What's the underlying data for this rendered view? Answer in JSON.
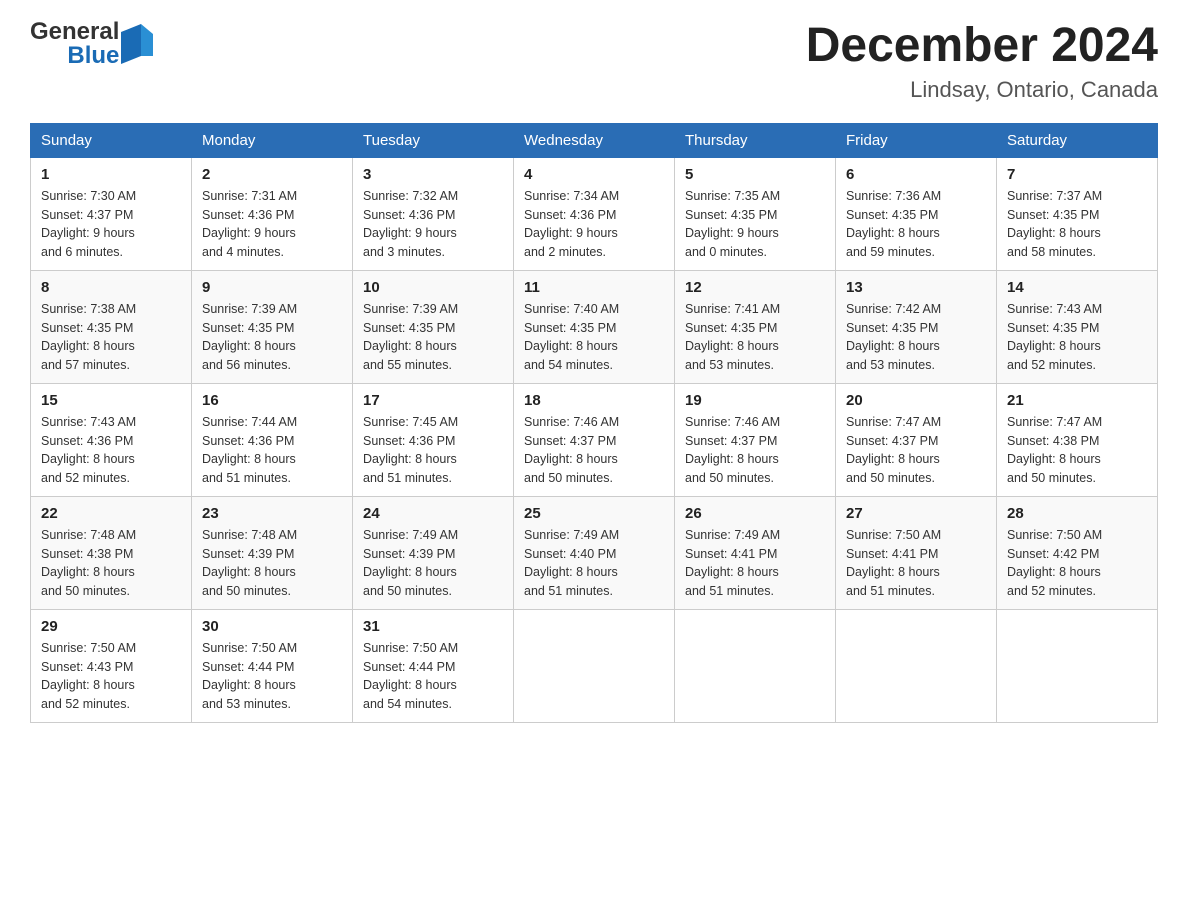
{
  "logo": {
    "text_general": "General",
    "text_blue": "Blue"
  },
  "title": "December 2024",
  "location": "Lindsay, Ontario, Canada",
  "days_of_week": [
    "Sunday",
    "Monday",
    "Tuesday",
    "Wednesday",
    "Thursday",
    "Friday",
    "Saturday"
  ],
  "weeks": [
    [
      {
        "day": "1",
        "sunrise": "7:30 AM",
        "sunset": "4:37 PM",
        "daylight": "9 hours and 6 minutes."
      },
      {
        "day": "2",
        "sunrise": "7:31 AM",
        "sunset": "4:36 PM",
        "daylight": "9 hours and 4 minutes."
      },
      {
        "day": "3",
        "sunrise": "7:32 AM",
        "sunset": "4:36 PM",
        "daylight": "9 hours and 3 minutes."
      },
      {
        "day": "4",
        "sunrise": "7:34 AM",
        "sunset": "4:36 PM",
        "daylight": "9 hours and 2 minutes."
      },
      {
        "day": "5",
        "sunrise": "7:35 AM",
        "sunset": "4:35 PM",
        "daylight": "9 hours and 0 minutes."
      },
      {
        "day": "6",
        "sunrise": "7:36 AM",
        "sunset": "4:35 PM",
        "daylight": "8 hours and 59 minutes."
      },
      {
        "day": "7",
        "sunrise": "7:37 AM",
        "sunset": "4:35 PM",
        "daylight": "8 hours and 58 minutes."
      }
    ],
    [
      {
        "day": "8",
        "sunrise": "7:38 AM",
        "sunset": "4:35 PM",
        "daylight": "8 hours and 57 minutes."
      },
      {
        "day": "9",
        "sunrise": "7:39 AM",
        "sunset": "4:35 PM",
        "daylight": "8 hours and 56 minutes."
      },
      {
        "day": "10",
        "sunrise": "7:39 AM",
        "sunset": "4:35 PM",
        "daylight": "8 hours and 55 minutes."
      },
      {
        "day": "11",
        "sunrise": "7:40 AM",
        "sunset": "4:35 PM",
        "daylight": "8 hours and 54 minutes."
      },
      {
        "day": "12",
        "sunrise": "7:41 AM",
        "sunset": "4:35 PM",
        "daylight": "8 hours and 53 minutes."
      },
      {
        "day": "13",
        "sunrise": "7:42 AM",
        "sunset": "4:35 PM",
        "daylight": "8 hours and 53 minutes."
      },
      {
        "day": "14",
        "sunrise": "7:43 AM",
        "sunset": "4:35 PM",
        "daylight": "8 hours and 52 minutes."
      }
    ],
    [
      {
        "day": "15",
        "sunrise": "7:43 AM",
        "sunset": "4:36 PM",
        "daylight": "8 hours and 52 minutes."
      },
      {
        "day": "16",
        "sunrise": "7:44 AM",
        "sunset": "4:36 PM",
        "daylight": "8 hours and 51 minutes."
      },
      {
        "day": "17",
        "sunrise": "7:45 AM",
        "sunset": "4:36 PM",
        "daylight": "8 hours and 51 minutes."
      },
      {
        "day": "18",
        "sunrise": "7:46 AM",
        "sunset": "4:37 PM",
        "daylight": "8 hours and 50 minutes."
      },
      {
        "day": "19",
        "sunrise": "7:46 AM",
        "sunset": "4:37 PM",
        "daylight": "8 hours and 50 minutes."
      },
      {
        "day": "20",
        "sunrise": "7:47 AM",
        "sunset": "4:37 PM",
        "daylight": "8 hours and 50 minutes."
      },
      {
        "day": "21",
        "sunrise": "7:47 AM",
        "sunset": "4:38 PM",
        "daylight": "8 hours and 50 minutes."
      }
    ],
    [
      {
        "day": "22",
        "sunrise": "7:48 AM",
        "sunset": "4:38 PM",
        "daylight": "8 hours and 50 minutes."
      },
      {
        "day": "23",
        "sunrise": "7:48 AM",
        "sunset": "4:39 PM",
        "daylight": "8 hours and 50 minutes."
      },
      {
        "day": "24",
        "sunrise": "7:49 AM",
        "sunset": "4:39 PM",
        "daylight": "8 hours and 50 minutes."
      },
      {
        "day": "25",
        "sunrise": "7:49 AM",
        "sunset": "4:40 PM",
        "daylight": "8 hours and 51 minutes."
      },
      {
        "day": "26",
        "sunrise": "7:49 AM",
        "sunset": "4:41 PM",
        "daylight": "8 hours and 51 minutes."
      },
      {
        "day": "27",
        "sunrise": "7:50 AM",
        "sunset": "4:41 PM",
        "daylight": "8 hours and 51 minutes."
      },
      {
        "day": "28",
        "sunrise": "7:50 AM",
        "sunset": "4:42 PM",
        "daylight": "8 hours and 52 minutes."
      }
    ],
    [
      {
        "day": "29",
        "sunrise": "7:50 AM",
        "sunset": "4:43 PM",
        "daylight": "8 hours and 52 minutes."
      },
      {
        "day": "30",
        "sunrise": "7:50 AM",
        "sunset": "4:44 PM",
        "daylight": "8 hours and 53 minutes."
      },
      {
        "day": "31",
        "sunrise": "7:50 AM",
        "sunset": "4:44 PM",
        "daylight": "8 hours and 54 minutes."
      },
      null,
      null,
      null,
      null
    ]
  ],
  "labels": {
    "sunrise": "Sunrise:",
    "sunset": "Sunset:",
    "daylight": "Daylight:"
  }
}
